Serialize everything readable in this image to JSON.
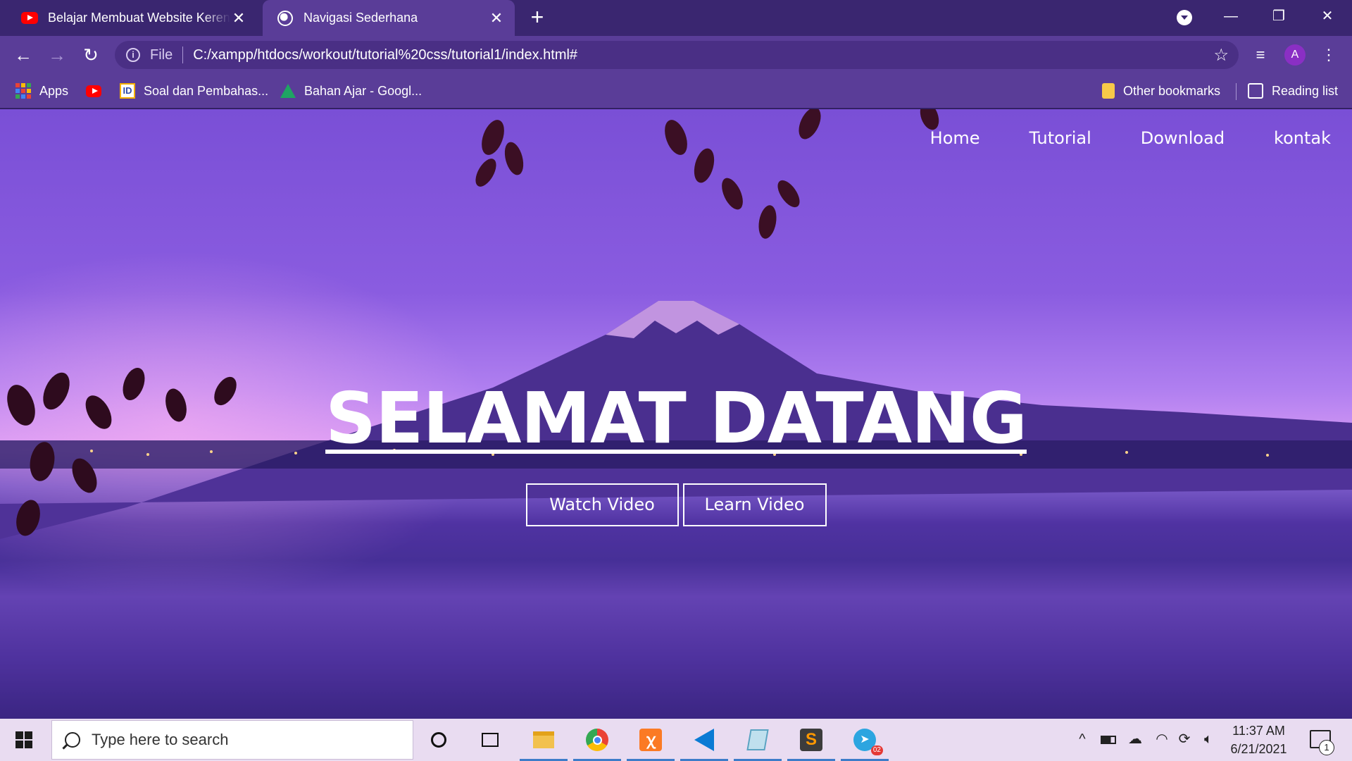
{
  "browser": {
    "tabs": [
      {
        "title": "Belajar Membuat Website Keren dengan",
        "favicon": "youtube-icon",
        "active": false
      },
      {
        "title": "Navigasi Sederhana",
        "favicon": "globe-icon",
        "active": true
      }
    ],
    "address": {
      "scheme_label": "File",
      "url": "C:/xampp/htdocs/workout/tutorial%20css/tutorial1/index.html#"
    },
    "profile_initial": "A",
    "bookmarks": [
      {
        "label": "Apps",
        "icon": "apps-grid-icon"
      },
      {
        "label": "",
        "icon": "youtube-icon"
      },
      {
        "label": "Soal dan Pembahas...",
        "icon": "id-icon"
      },
      {
        "label": "Bahan Ajar - Googl...",
        "icon": "google-drive-icon"
      },
      {
        "label": "Other bookmarks",
        "icon": "folder-icon"
      },
      {
        "label": "Reading list",
        "icon": "reading-list-icon"
      }
    ]
  },
  "page": {
    "nav": [
      "Home",
      "Tutorial",
      "Download",
      "kontak"
    ],
    "title": "SELAMAT DATANG",
    "buttons": [
      "Watch Video",
      "Learn Video"
    ]
  },
  "taskbar": {
    "search_placeholder": "Type here to search",
    "time": "11:37 AM",
    "date": "6/21/2021",
    "telegram_badge": "02",
    "notification_count": "1",
    "pinned": [
      "cortana-icon",
      "task-view-icon",
      "file-explorer-icon",
      "chrome-icon",
      "xampp-icon",
      "vscode-icon",
      "notepad-icon",
      "sublime-text-icon",
      "telegram-icon"
    ]
  },
  "colors": {
    "tab_strip": "#3a2670",
    "toolbar": "#5a3d98",
    "taskbar": "#e9dcf1"
  }
}
